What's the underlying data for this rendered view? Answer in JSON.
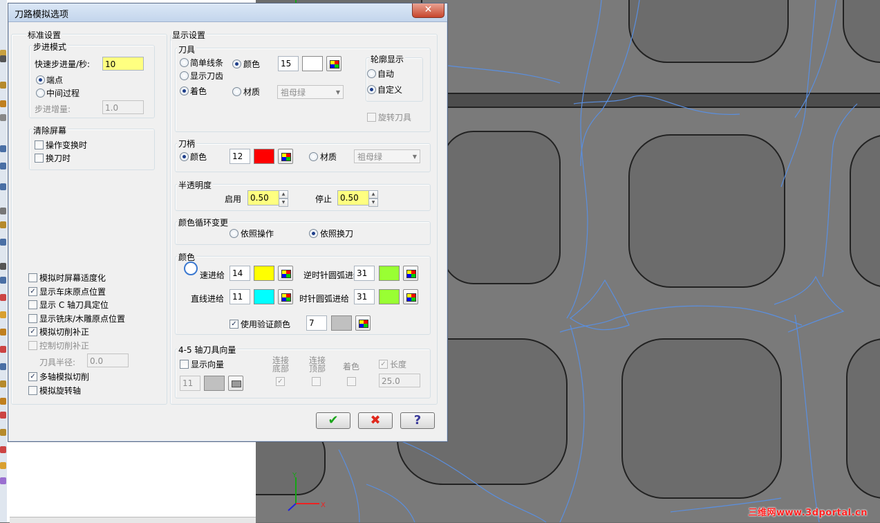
{
  "dialog": {
    "title": "刀路模拟选项",
    "close_label": "✕"
  },
  "standard": {
    "title": "标准设置",
    "step_mode": {
      "title": "步进模式",
      "fast_step_label": "快速步进量/秒:",
      "fast_step_value": "10",
      "endpoint_label": "端点",
      "midprocess_label": "中间过程",
      "step_increment_label": "步进增量:",
      "step_increment_value": "1.0"
    },
    "clear_screen": {
      "title": "清除屏幕",
      "on_op_change": "操作变换时",
      "on_tool_change": "换刀时"
    },
    "options": {
      "fit_screen": "模拟时屏幕适度化",
      "show_lathe_origin": "显示车床原点位置",
      "show_c_axis": "显示 C 轴刀具定位",
      "show_mill_origin": "显示铣床/木雕原点位置",
      "sim_cutter_comp": "模拟切削补正",
      "control_cutter_comp": "控制切削补正",
      "tool_radius_label": "刀具半径:",
      "tool_radius_value": "0.0",
      "multiaxis_sim": "多轴模拟切削",
      "sim_rotary": "模拟旋转轴"
    }
  },
  "display": {
    "title": "显示设置",
    "tool": {
      "title": "刀具",
      "simple_wire": "简单线条",
      "show_teeth": "显示刀齿",
      "shaded": "着色",
      "color_label": "颜色",
      "color_value": "15",
      "material_label": "材质",
      "material_value": "祖母绿",
      "outline_title": "轮廓显示",
      "auto": "自动",
      "custom": "自定义",
      "rotate_tool": "旋转刀具"
    },
    "holder": {
      "title": "刀柄",
      "color_label": "颜色",
      "color_value": "12",
      "material_label": "材质",
      "material_value": "祖母绿"
    },
    "transparency": {
      "title": "半透明度",
      "enable_label": "启用",
      "enable_value": "0.50",
      "stop_label": "停止",
      "stop_value": "0.50"
    },
    "cycle": {
      "title": "颜色循环变更",
      "by_operation": "依照操作",
      "by_tool_change": "依照换刀"
    },
    "colors": {
      "title": "颜色",
      "rapid_label": "速进给",
      "rapid_value": "14",
      "ccw_arc_label": "逆时针圆弧进给",
      "ccw_arc_value": "31",
      "linear_label": "直线进给",
      "linear_value": "11",
      "cw_arc_label": "时针圆弧进给",
      "cw_arc_value": "31",
      "use_verify_label": "使用验证颜色",
      "use_verify_value": "7"
    },
    "axis45": {
      "title": "4-5 轴刀具向量",
      "show_vector": "显示向量",
      "vector_value": "11",
      "connect_bottom": "连接底部",
      "connect_top": "连接顶部",
      "shade": "着色",
      "length_label": "长度",
      "length_value": "25.0"
    }
  },
  "buttons": {
    "ok": "✔",
    "cancel": "✖",
    "help": "?"
  },
  "viewport": {
    "axis_y": "Y",
    "axis_x": "X",
    "watermark": "三维网www.3dportal.cn"
  },
  "colors": {
    "tool_color": "#ffffff",
    "holder_color": "#ff0000",
    "rapid_color": "#ffff00",
    "arc_color": "#99ff33",
    "linear_color": "#00ffff",
    "verify_color": "#c0c0c0",
    "vector_color": "#c0c0c0"
  }
}
